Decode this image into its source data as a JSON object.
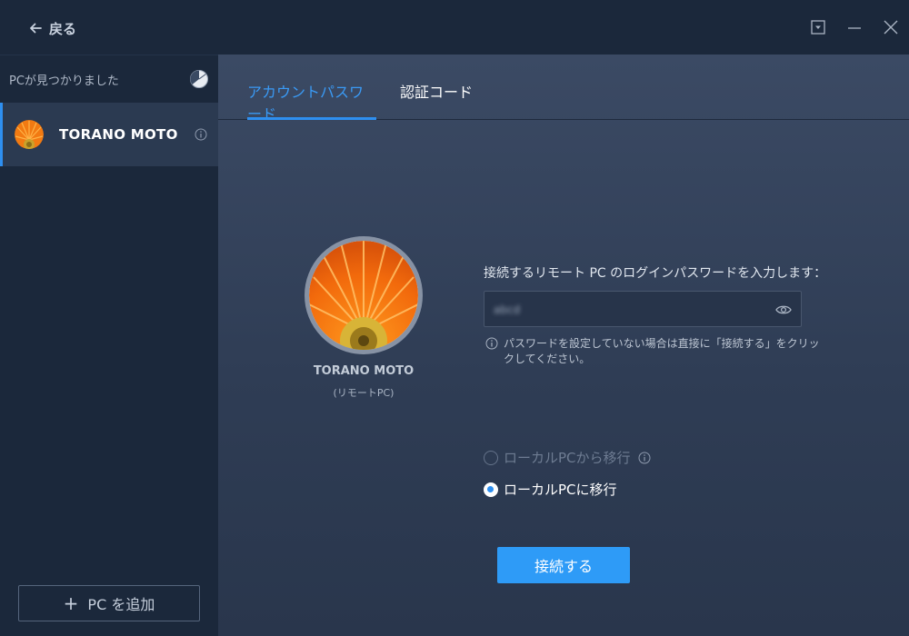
{
  "titlebar": {
    "back_label": "戻る"
  },
  "sidebar": {
    "header": "PCが見つかりました",
    "pc_items": [
      {
        "name": "TORANO MOTO"
      }
    ],
    "add_pc_label": "PC を追加"
  },
  "main": {
    "tabs": [
      {
        "label": "アカウントパスワード",
        "active": true
      },
      {
        "label": "認証コード",
        "active": false
      }
    ],
    "remote": {
      "name": "TORANO MOTO",
      "subtitle": "(リモートPC)"
    },
    "password": {
      "label": "接続するリモート PC のログインパスワードを入力します：",
      "value": "abcd",
      "hint": "パスワードを設定していない場合は直接に「接続する」をクリックしてください。"
    },
    "options": [
      {
        "label": "ローカルPCから移行",
        "selected": false,
        "disabled": true
      },
      {
        "label": "ローカルPCに移行",
        "selected": true,
        "disabled": false
      }
    ],
    "connect_label": "接続する"
  },
  "colors": {
    "accent": "#2e8ff0",
    "sidebar_bg": "#1b283b",
    "main_bg": "#344259"
  },
  "icons": [
    "arrow-left-icon",
    "dropdown-icon",
    "minimize-icon",
    "close-icon",
    "spinner-icon",
    "info-icon",
    "eye-icon",
    "plus-icon"
  ]
}
